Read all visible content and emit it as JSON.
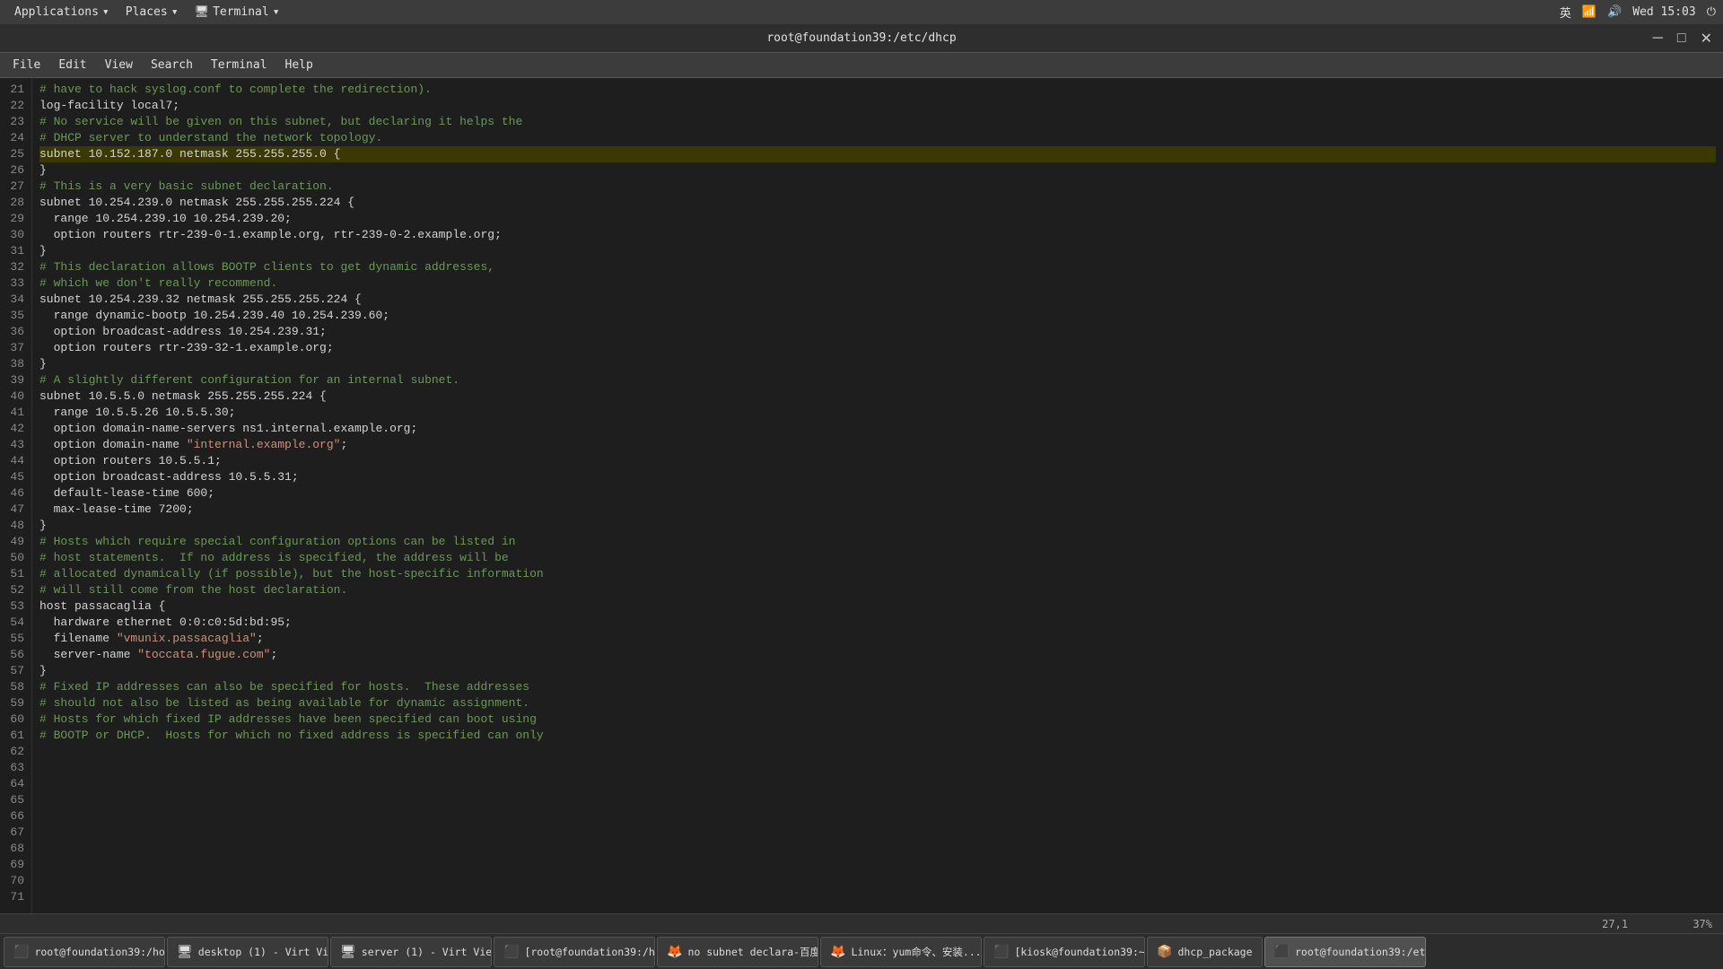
{
  "topbar": {
    "apps_label": "Applications",
    "places_label": "Places",
    "terminal_label": "Terminal",
    "datetime": "Wed 15:03",
    "lang": "英"
  },
  "titlebar": {
    "title": "root@foundation39:/etc/dhcp"
  },
  "menubar": {
    "items": [
      "File",
      "Edit",
      "View",
      "Search",
      "Terminal",
      "Help"
    ]
  },
  "statusbar": {
    "position": "27,1",
    "percent": "37%"
  },
  "taskbar": {
    "items": [
      {
        "label": "root@foundation39:/ho...",
        "icon_color": "#333"
      },
      {
        "label": "desktop (1) - Virt View...",
        "icon_color": "#555"
      },
      {
        "label": "server (1) - Virt Viewer",
        "icon_color": "#555"
      },
      {
        "label": "[root@foundation39:/h...",
        "icon_color": "#333"
      },
      {
        "label": "no subnet declara-百度...",
        "icon_color": "#e85"
      },
      {
        "label": "Linux：yum命令、安装...",
        "icon_color": "#e85"
      },
      {
        "label": "[kiosk@foundation39:~]",
        "icon_color": "#333"
      },
      {
        "label": "dhcp_package",
        "icon_color": "#555"
      },
      {
        "label": "root@foundation39:/et",
        "icon_color": "#333"
      }
    ]
  },
  "code": {
    "lines": [
      {
        "num": 21,
        "text": "# have to hack syslog.conf to complete the redirection).",
        "type": "comment"
      },
      {
        "num": 22,
        "text": "log-facility local7;",
        "type": "normal"
      },
      {
        "num": 23,
        "text": "",
        "type": "normal"
      },
      {
        "num": 24,
        "text": "# No service will be given on this subnet, but declaring it helps the",
        "type": "comment"
      },
      {
        "num": 25,
        "text": "# DHCP server to understand the network topology.",
        "type": "comment"
      },
      {
        "num": 26,
        "text": "",
        "type": "normal"
      },
      {
        "num": 27,
        "text": "subnet 10.152.187.0 netmask 255.255.255.0 {",
        "type": "mixed_27"
      },
      {
        "num": 28,
        "text": "}",
        "type": "normal"
      },
      {
        "num": 29,
        "text": "",
        "type": "normal"
      },
      {
        "num": 30,
        "text": "# This is a very basic subnet declaration.",
        "type": "comment"
      },
      {
        "num": 31,
        "text": "",
        "type": "normal"
      },
      {
        "num": 32,
        "text": "subnet 10.254.239.0 netmask 255.255.255.224 {",
        "type": "normal"
      },
      {
        "num": 33,
        "text": "  range 10.254.239.10 10.254.239.20;",
        "type": "normal"
      },
      {
        "num": 34,
        "text": "  option routers rtr-239-0-1.example.org, rtr-239-0-2.example.org;",
        "type": "normal"
      },
      {
        "num": 35,
        "text": "}",
        "type": "normal"
      },
      {
        "num": 36,
        "text": "",
        "type": "normal"
      },
      {
        "num": 37,
        "text": "# This declaration allows BOOTP clients to get dynamic addresses,",
        "type": "comment"
      },
      {
        "num": 38,
        "text": "# which we don't really recommend.",
        "type": "comment"
      },
      {
        "num": 39,
        "text": "",
        "type": "normal"
      },
      {
        "num": 40,
        "text": "subnet 10.254.239.32 netmask 255.255.255.224 {",
        "type": "normal"
      },
      {
        "num": 41,
        "text": "  range dynamic-bootp 10.254.239.40 10.254.239.60;",
        "type": "normal"
      },
      {
        "num": 42,
        "text": "  option broadcast-address 10.254.239.31;",
        "type": "normal"
      },
      {
        "num": 43,
        "text": "  option routers rtr-239-32-1.example.org;",
        "type": "normal"
      },
      {
        "num": 44,
        "text": "}",
        "type": "normal"
      },
      {
        "num": 45,
        "text": "",
        "type": "normal"
      },
      {
        "num": 46,
        "text": "# A slightly different configuration for an internal subnet.",
        "type": "comment"
      },
      {
        "num": 47,
        "text": "subnet 10.5.5.0 netmask 255.255.255.224 {",
        "type": "normal"
      },
      {
        "num": 48,
        "text": "  range 10.5.5.26 10.5.5.30;",
        "type": "normal"
      },
      {
        "num": 49,
        "text": "  option domain-name-servers ns1.internal.example.org;",
        "type": "normal"
      },
      {
        "num": 50,
        "text": "  option domain-name \"internal.example.org\";",
        "type": "mixed_50"
      },
      {
        "num": 51,
        "text": "  option routers 10.5.5.1;",
        "type": "normal"
      },
      {
        "num": 52,
        "text": "  option broadcast-address 10.5.5.31;",
        "type": "normal"
      },
      {
        "num": 53,
        "text": "  default-lease-time 600;",
        "type": "normal"
      },
      {
        "num": 54,
        "text": "  max-lease-time 7200;",
        "type": "normal"
      },
      {
        "num": 55,
        "text": "}",
        "type": "normal"
      },
      {
        "num": 56,
        "text": "",
        "type": "normal"
      },
      {
        "num": 57,
        "text": "# Hosts which require special configuration options can be listed in",
        "type": "comment"
      },
      {
        "num": 58,
        "text": "# host statements.  If no address is specified, the address will be",
        "type": "comment"
      },
      {
        "num": 59,
        "text": "# allocated dynamically (if possible), but the host-specific information",
        "type": "comment"
      },
      {
        "num": 60,
        "text": "# will still come from the host declaration.",
        "type": "comment"
      },
      {
        "num": 61,
        "text": "",
        "type": "normal"
      },
      {
        "num": 62,
        "text": "host passacaglia {",
        "type": "normal"
      },
      {
        "num": 63,
        "text": "  hardware ethernet 0:0:c0:5d:bd:95;",
        "type": "normal"
      },
      {
        "num": 64,
        "text": "  filename \"vmunix.passacaglia\";",
        "type": "mixed_64"
      },
      {
        "num": 65,
        "text": "  server-name \"toccata.fugue.com\";",
        "type": "mixed_65"
      },
      {
        "num": 66,
        "text": "}",
        "type": "normal"
      },
      {
        "num": 67,
        "text": "",
        "type": "normal"
      },
      {
        "num": 68,
        "text": "# Fixed IP addresses can also be specified for hosts.  These addresses",
        "type": "comment"
      },
      {
        "num": 69,
        "text": "# should not also be listed as being available for dynamic assignment.",
        "type": "comment"
      },
      {
        "num": 70,
        "text": "# Hosts for which fixed IP addresses have been specified can boot using",
        "type": "comment"
      },
      {
        "num": 71,
        "text": "# BOOTP or DHCP.  Hosts for which no fixed address is specified can only",
        "type": "comment"
      }
    ]
  }
}
